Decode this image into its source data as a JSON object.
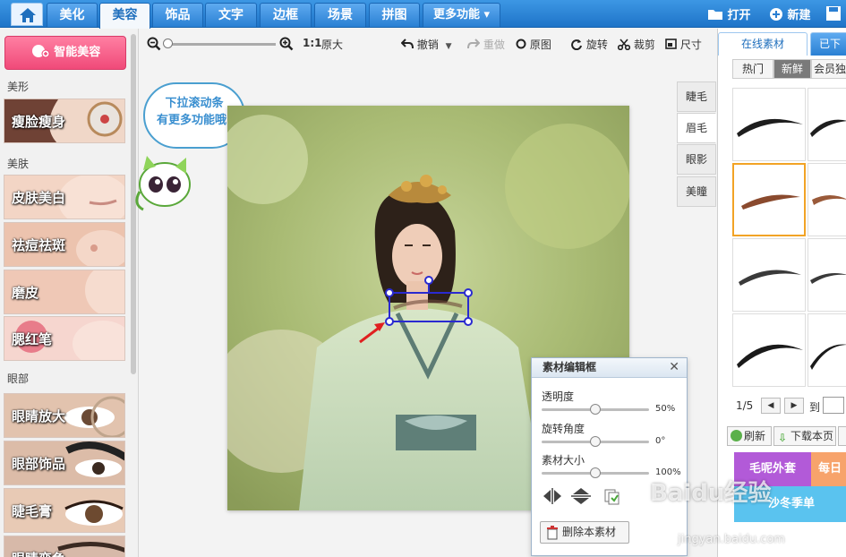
{
  "nav": {
    "tabs": [
      {
        "label": "美化"
      },
      {
        "label": "美容"
      },
      {
        "label": "饰品"
      },
      {
        "label": "文字"
      },
      {
        "label": "边框"
      },
      {
        "label": "场景"
      },
      {
        "label": "拼图"
      },
      {
        "label": "更多功能 ▾"
      }
    ],
    "open_label": "打开",
    "new_label": "新建"
  },
  "left": {
    "smart_label": "智能美容",
    "sections": {
      "shape": "美形",
      "skin": "美肤",
      "eyes": "眼部"
    },
    "features": [
      {
        "label": "瘦脸瘦身",
        "colors": [
          "#8d5a45",
          "#e7c3a5"
        ]
      },
      {
        "label": "皮肤美白",
        "colors": [
          "#e8c0ad",
          "#f7e0d3"
        ]
      },
      {
        "label": "祛痘祛斑",
        "colors": [
          "#d7a792",
          "#f1cbb8"
        ]
      },
      {
        "label": "磨皮",
        "colors": [
          "#e2b7a3",
          "#f5d8ca"
        ]
      },
      {
        "label": "腮红笔",
        "colors": [
          "#e8a6a8",
          "#f8d3cf"
        ]
      },
      {
        "label": "眼睛放大",
        "colors": [
          "#c49a80",
          "#e7c9b4"
        ]
      },
      {
        "label": "眼部饰品",
        "colors": [
          "#8a6a58",
          "#e2c1ad"
        ]
      },
      {
        "label": "睫毛膏",
        "colors": [
          "#b58d74",
          "#e9cbb7"
        ]
      },
      {
        "label": "眼睛变色",
        "colors": [
          "#9a7a68",
          "#d6b8a8"
        ]
      }
    ]
  },
  "toolbar": {
    "ratio": "1:1",
    "original_size": "原大",
    "undo": "撤销",
    "redo": "重做",
    "original": "原图",
    "rotate": "旋转",
    "crop": "裁剪",
    "size": "尺寸"
  },
  "bubble": {
    "line1": "下拉滚动条",
    "line2": "有更多功能哦!"
  },
  "side_tabs": [
    {
      "label": "睫毛"
    },
    {
      "label": "眉毛"
    },
    {
      "label": "眼影"
    },
    {
      "label": "美瞳"
    }
  ],
  "right": {
    "tab_online": "在线素材",
    "tab_downloaded": "已下",
    "sub_hot": "热门",
    "sub_new": "新鲜",
    "sub_member": "会员独",
    "page": "1/5",
    "goto": "到",
    "refresh": "刷新",
    "download_page": "下载本页",
    "banner1": "毛呢外套",
    "banner2": "每日",
    "banner3": "沙冬季单"
  },
  "editor": {
    "title": "素材编辑框",
    "opacity_label": "透明度",
    "opacity_value": "50%",
    "opacity_level": 0.5,
    "rotation_label": "旋转角度",
    "rotation_value": "0°",
    "rotation_level": 0.5,
    "size_label": "素材大小",
    "size_value": "100%",
    "size_level": 0.5,
    "delete_label": "删除本素材"
  },
  "watermark": {
    "brand": "Baidu经验",
    "url": "jingyan.baidu.com"
  }
}
